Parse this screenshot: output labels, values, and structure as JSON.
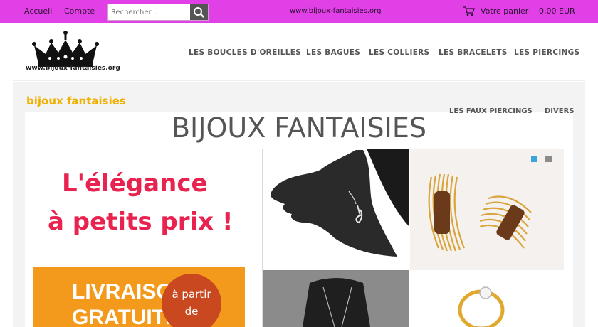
{
  "topbar": {
    "account_links": [
      "Accueil",
      "Compte"
    ],
    "search_placeholder": "Rechercher...",
    "site_url": "www.bijoux-fantaisies.org",
    "cart_label": "Votre panier",
    "cart_total": "0,00 EUR",
    "bg_color": "#e040e6"
  },
  "header": {
    "logo_text": "www.bijoux-fantaisies.org",
    "nav": [
      "LES BOUCLES D'OREILLES",
      "LES BAGUES",
      "LES COLLIERS",
      "LES BRACELETS",
      "LES PIERCINGS"
    ]
  },
  "content": {
    "section_title": "bijoux fantaisies",
    "nav2": [
      "LES FAUX PIERCINGS",
      "DIVERS"
    ],
    "big_title": "BIJOUX FANTAISIES",
    "promo1": {
      "line1": "L'élégance",
      "line2": "à petits prix !"
    },
    "promo2": {
      "line1": "LIVRAISON",
      "line2": "GRATUITE",
      "badge1": "à partir",
      "badge2": "de"
    },
    "slider_dots": [
      "active",
      "inactive"
    ],
    "accent": "#f0b000",
    "promo_red": "#e8234f",
    "promo_orange": "#f39a1c"
  }
}
